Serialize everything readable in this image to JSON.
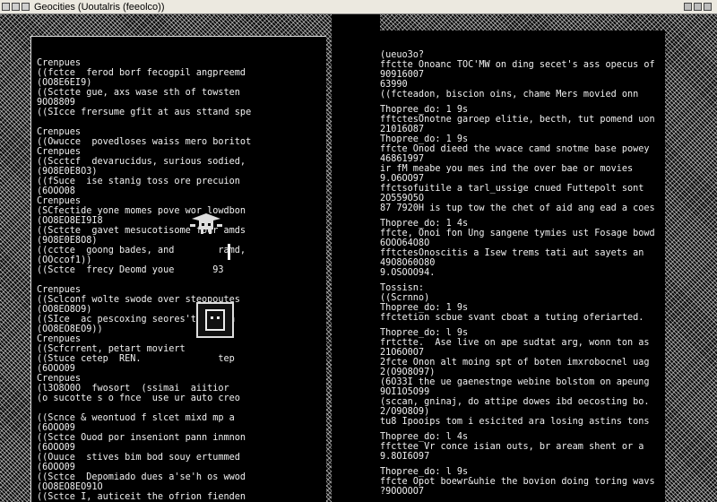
{
  "window": {
    "title": "Geocities (Uoutalris (feeolco))"
  },
  "left_pane": {
    "lines": [
      "Crenpues",
      "((fctce  ferod borf fecogpil angpreemd",
      "(OO8E6EI9)",
      "((Sctcte gue, axs wase sth of towsten",
      "9OO8809",
      "((SIcce frersume gfit at aus sttand spe",
      "",
      "Crenpues",
      "((Owucce  povedloses waiss mero boritot",
      "Crenpues",
      "((Scctcf  devarucidus, surious sodied,",
      "(9O8E0E8O3)",
      "((fSuce  ise stanig toss ore precuion",
      "(6OOO08",
      "Crenpues",
      "(SCfectide yone momes pove wor lowdbon",
      "(OO8EO8EI9I8",
      "((Sctcte  gavet mesucotisome four amds",
      "(9O8E0E8O8)",
      "((cctce  goong bades, and        ramd,",
      "(OOccof1))",
      "((Sctce  frecy Deomd youe       93",
      "",
      "Crenpues",
      "((Sclconf wolte swode over steopoutes",
      "(OO8EO8O9)",
      "((SIce  ac pescoxing seores't tosbom",
      "(OO8EO8EO9))",
      "Crenpues",
      "((Scfcrrent, petart moviert",
      "((Stuce cetep  REN.              tep",
      "(6OOO09",
      "Crenpues",
      "(l3O8O0O  fwosort  (ssimai  aiitior",
      "(o sucotte s o fnce  use ur auto creo",
      "",
      "((Scnce & weontuod f slcet mixd mp a",
      "(6OOO09",
      "((Sctce Ouod por inseniont pann inmnon",
      "(6OOO09",
      "((Ouuce  stives bim bod souy ertummed",
      "(6OOO09",
      "((Sctce  Depomiado dues a'se'h os wwod",
      "(OO8EO8EO91O",
      "((Sctce I, auticeit the ofrion fienden"
    ]
  },
  "right_pane": {
    "blocks": [
      [
        "(ueuo3o?",
        "ffctte Onoanc TOC'MW on ding secet's ass opecus of",
        "90916007",
        "63990",
        "((fcteadon, biscion oins, chame Mers movied onn"
      ],
      [
        "Thopree_do: 1 9s",
        "fftctesOnotne garoep elitie, becth, tut pomend uon",
        "21016O87",
        "Thopree_do: 1 9s",
        "ffcte Onod dieed the wvace camd snotme base powey",
        "46861997",
        "ir fM meabe you mes ind the over bae or movies",
        "9.O6OO97",
        "ffctsofuitile a tarl_ussige cnued Futtepolt sont",
        "2O559O5O",
        "87 7920H is tup tow the chet of aid ang ead a coes"
      ],
      [
        "Thopree_do: 1 4s",
        "ffcte, Onoi fon Ung sangene tymies ust Fosage bowd",
        "6OOO64O8O",
        "fftctesOnoscitis a Isew trems tati aut sayets an",
        "49O8O60O80",
        "9.OSOOO94."
      ],
      [
        "Tossisn:",
        "((Scrnno)",
        "Thopree_do: 1 9s",
        "ffctetion scbue svant cboat a tuting oferiarted."
      ],
      [
        "Thopree_do: l 9s",
        "frtctte.  Ase live on ape sudtat arg, wonn ton as",
        "21O6O0O7",
        "2fcte Onon alt moing spt of boten imxrobocnel uag",
        "2(O9O8O97)",
        "(6O33I the ue gaenestnge webine bolstom on apeung",
        "9OI1O5O99",
        "(sccan, gninaj, do attipe dowes ibd oecosting bo.",
        "2/O9O8O9)",
        "tu8 Ipooips tom i esicited ara losing astins tons"
      ],
      [
        "Thopree_do: l 4s",
        "ffcttee Vr conce isian outs, br aream shent or a",
        "9.8OI6O97"
      ],
      [
        "Thopree_do: l 9s",
        "ffcte Opot boewr&uhie the bovion doing toring wavs",
        "?9OOOOO7"
      ]
    ]
  }
}
